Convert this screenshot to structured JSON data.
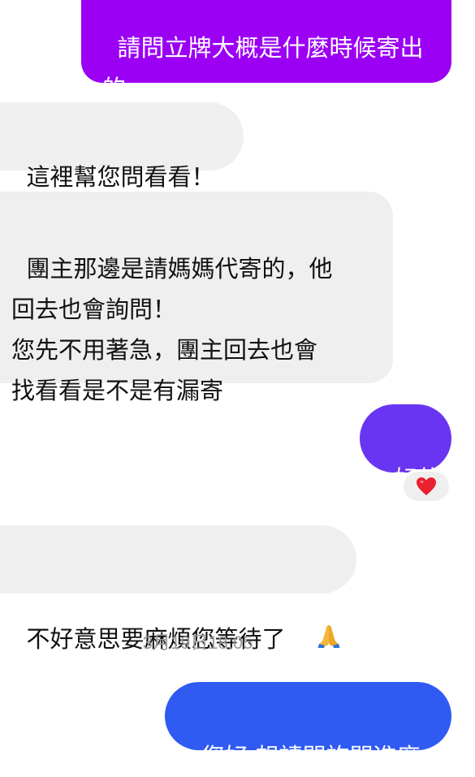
{
  "colors": {
    "outgoing_purple": "#9b00f5",
    "outgoing_violet": "#6a35f2",
    "outgoing_blue": "#2f5bf2",
    "incoming_bg": "#efefef",
    "reaction_heart": "#e8202f"
  },
  "messages": [
    {
      "direction": "outgoing",
      "text": "請問立牌大概是什麼時候寄出的"
    },
    {
      "direction": "incoming",
      "text": "這裡幫您問看看！"
    },
    {
      "direction": "incoming",
      "text": "團主那邊是請媽媽代寄的，他\n回去也會詢問！\n您先不用著急，團主回去也會\n找看看是不是有漏寄"
    },
    {
      "direction": "outgoing",
      "text": "好的",
      "reaction": "heart-icon"
    },
    {
      "direction": "incoming",
      "text": "不好意思要麻煩您等待了",
      "emoji": "folded-hands-icon"
    }
  ],
  "timestamp": "3月19日18:05",
  "last_message": {
    "direction": "outgoing",
    "text": "您好 想請問詢問進度"
  }
}
